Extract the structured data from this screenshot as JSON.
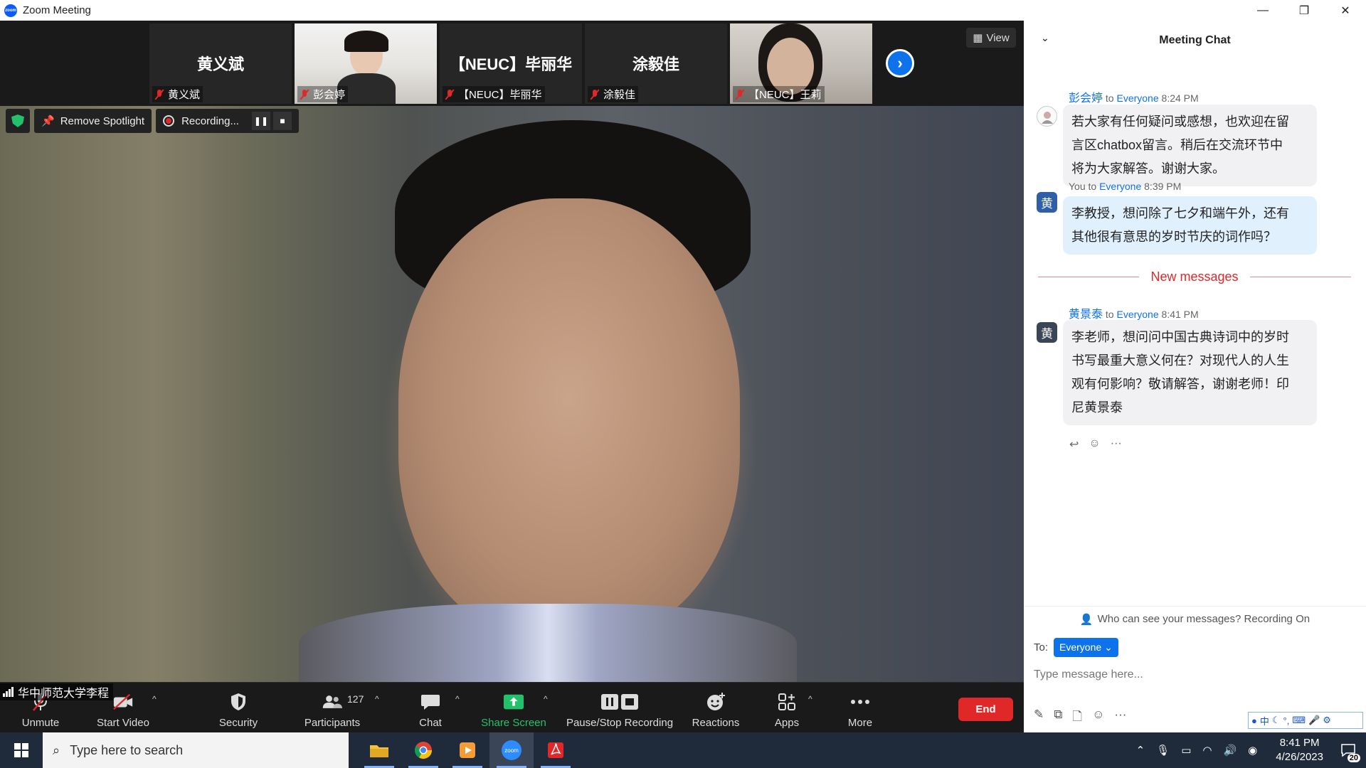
{
  "window": {
    "title": "Zoom Meeting",
    "app_icon": "zoom-logo",
    "min": "—",
    "restore": "❐",
    "close": "✕"
  },
  "strip": {
    "tiles": [
      {
        "display_name": "黄义斌",
        "label": "黄义斌",
        "video": false
      },
      {
        "display_name": "",
        "label": "彭会婷",
        "video": true
      },
      {
        "display_name": "【NEUC】毕丽华",
        "label": "【NEUC】毕丽华",
        "video": false
      },
      {
        "display_name": "涂毅佳",
        "label": "涂毅佳",
        "video": false
      },
      {
        "display_name": "",
        "label": "【NEUC】王莉",
        "video": true
      }
    ],
    "next_glyph": "›",
    "view_label": "View"
  },
  "spotlight_bar": {
    "remove_label": "Remove Spotlight",
    "recording_label": "Recording...",
    "pause_glyph": "❚❚",
    "stop_glyph": "■"
  },
  "main_video": {
    "speaker_name": "华中师范大学李程"
  },
  "toolbar": {
    "unmute": "Unmute",
    "start_video": "Start Video",
    "security": "Security",
    "participants": "Participants",
    "participants_count": "127",
    "chat": "Chat",
    "share_screen": "Share Screen",
    "pause_stop_recording": "Pause/Stop Recording",
    "reactions": "Reactions",
    "apps": "Apps",
    "more": "More",
    "end": "End",
    "caret": "^"
  },
  "chat": {
    "title": "Meeting Chat",
    "collapse_glyph": "⌄",
    "messages": [
      {
        "sender": "彭会婷",
        "to_word": "to",
        "to": "Everyone",
        "time": "8:24 PM",
        "avatar_glyph": "",
        "text_lines": [
          "若大家有任何疑问或感想，也欢迎在留",
          "言区chatbox留言。稍后在交流环节中",
          "将为大家解答。谢谢大家。"
        ]
      },
      {
        "sender": "You",
        "to_word": "to",
        "to": "Everyone",
        "time": "8:39 PM",
        "avatar_glyph": "黄",
        "text_lines": [
          "李教授，想问除了七夕和端午外，还有",
          "其他很有意思的岁时节庆的词作吗？"
        ]
      },
      {
        "sender": "黄景泰",
        "to_word": "to",
        "to": "Everyone",
        "time": "8:41 PM",
        "avatar_glyph": "黄",
        "text_lines": [
          "李老师，想问问中国古典诗词中的岁时",
          "书写最重大意义何在？对现代人的人生",
          "观有何影响？敬请解答，谢谢老师！印",
          "尼黄景泰"
        ]
      }
    ],
    "new_messages_label": "New messages",
    "who_can_see": "Who can see your messages? Recording On",
    "to_label": "To:",
    "to_value": "Everyone",
    "input_placeholder": "Type message here...",
    "ime_label": "中",
    "colors": {
      "accent": "#0e72ed",
      "alert": "#e02828",
      "mine_bubble": "#e1f0fd",
      "other_bubble": "#f1f1f3"
    }
  },
  "taskbar": {
    "search_placeholder": "Type here to search",
    "time": "8:41 PM",
    "date": "4/26/2023",
    "notification_count": "20"
  }
}
